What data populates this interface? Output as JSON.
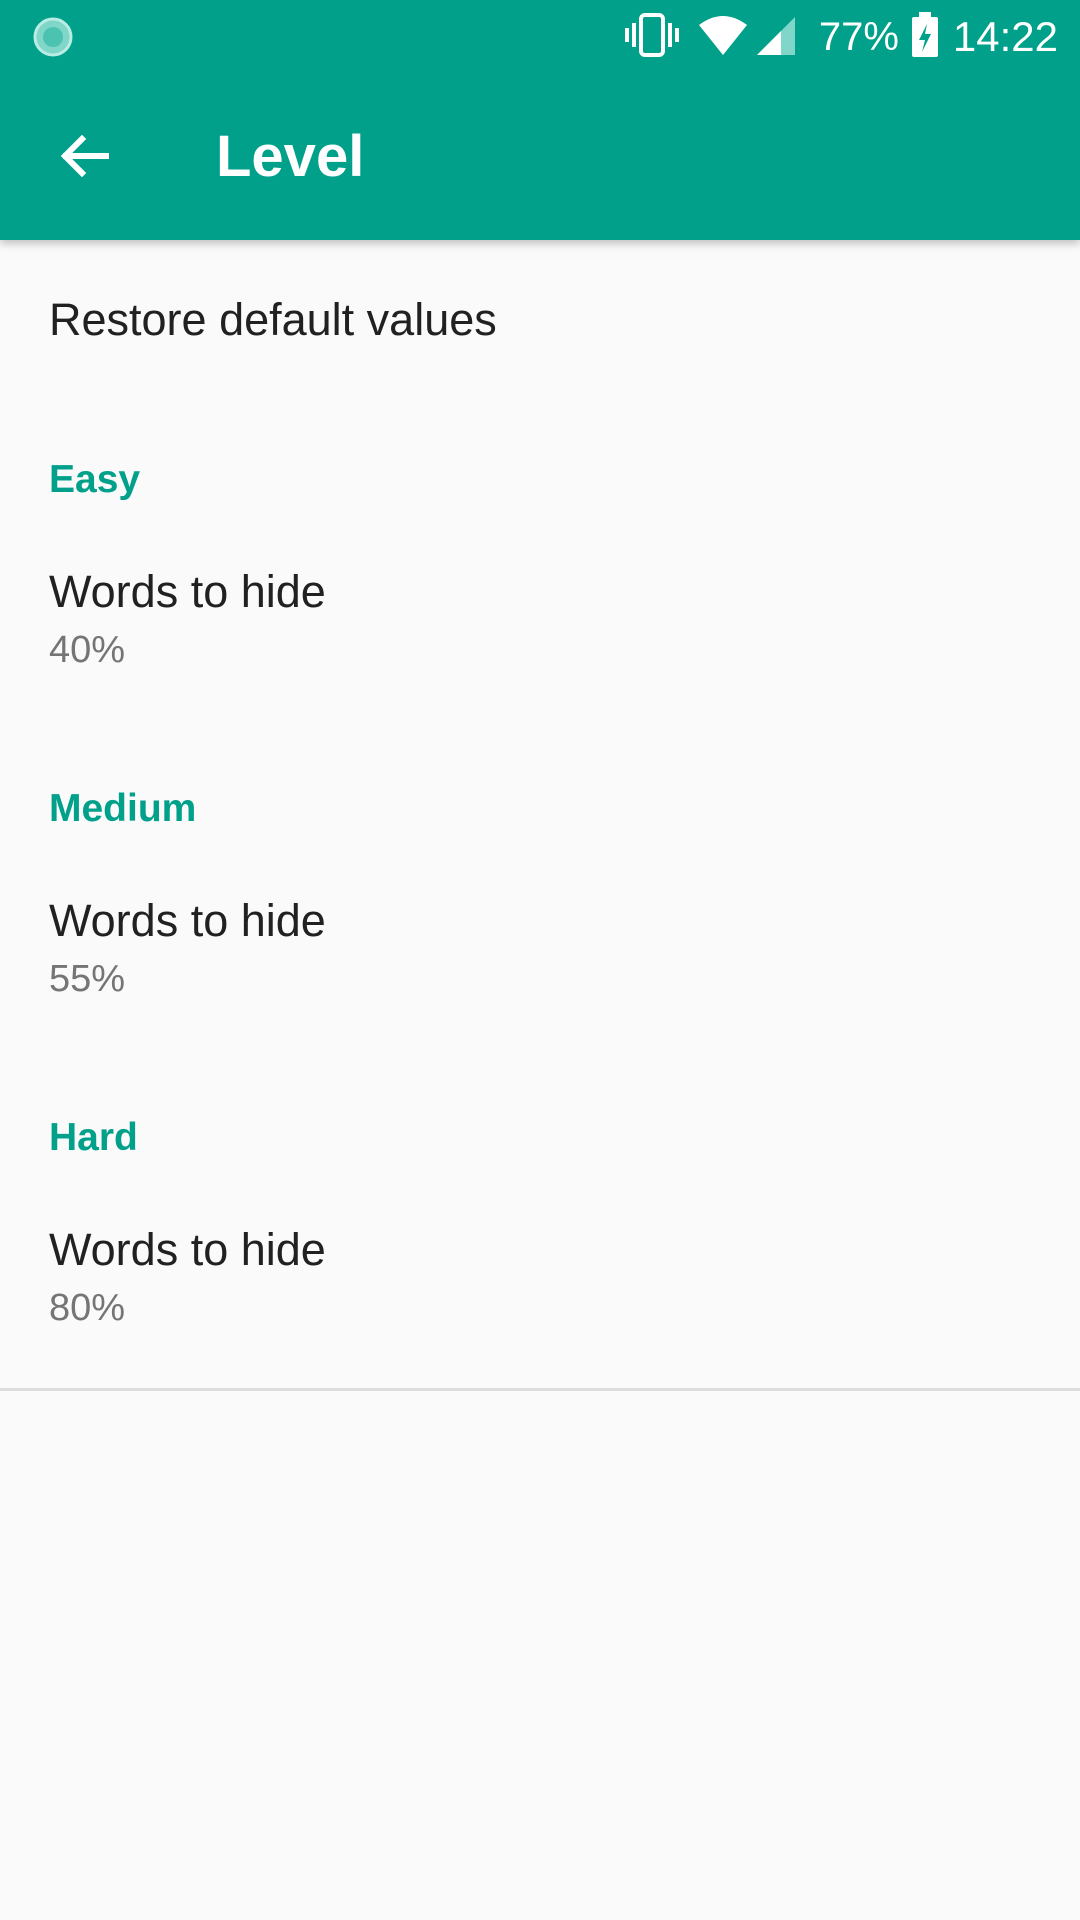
{
  "status_bar": {
    "left_icon": "loading-circle-icon",
    "icons": [
      "vibrate-icon",
      "wifi-icon",
      "cell-signal-icon",
      "battery-charging-icon"
    ],
    "battery_percent": "77%",
    "time": "14:22"
  },
  "toolbar": {
    "back_icon": "arrow-back-icon",
    "title": "Level"
  },
  "preferences": {
    "restore": {
      "title": "Restore default values"
    },
    "categories": [
      {
        "label": "Easy",
        "item": {
          "title": "Words to hide",
          "summary": "40%"
        }
      },
      {
        "label": "Medium",
        "item": {
          "title": "Words to hide",
          "summary": "55%"
        }
      },
      {
        "label": "Hard",
        "item": {
          "title": "Words to hide",
          "summary": "80%"
        }
      }
    ]
  },
  "colors": {
    "primary": "#00a08a",
    "background": "#fafafa",
    "title_text": "#212121",
    "summary_text": "#757575"
  }
}
